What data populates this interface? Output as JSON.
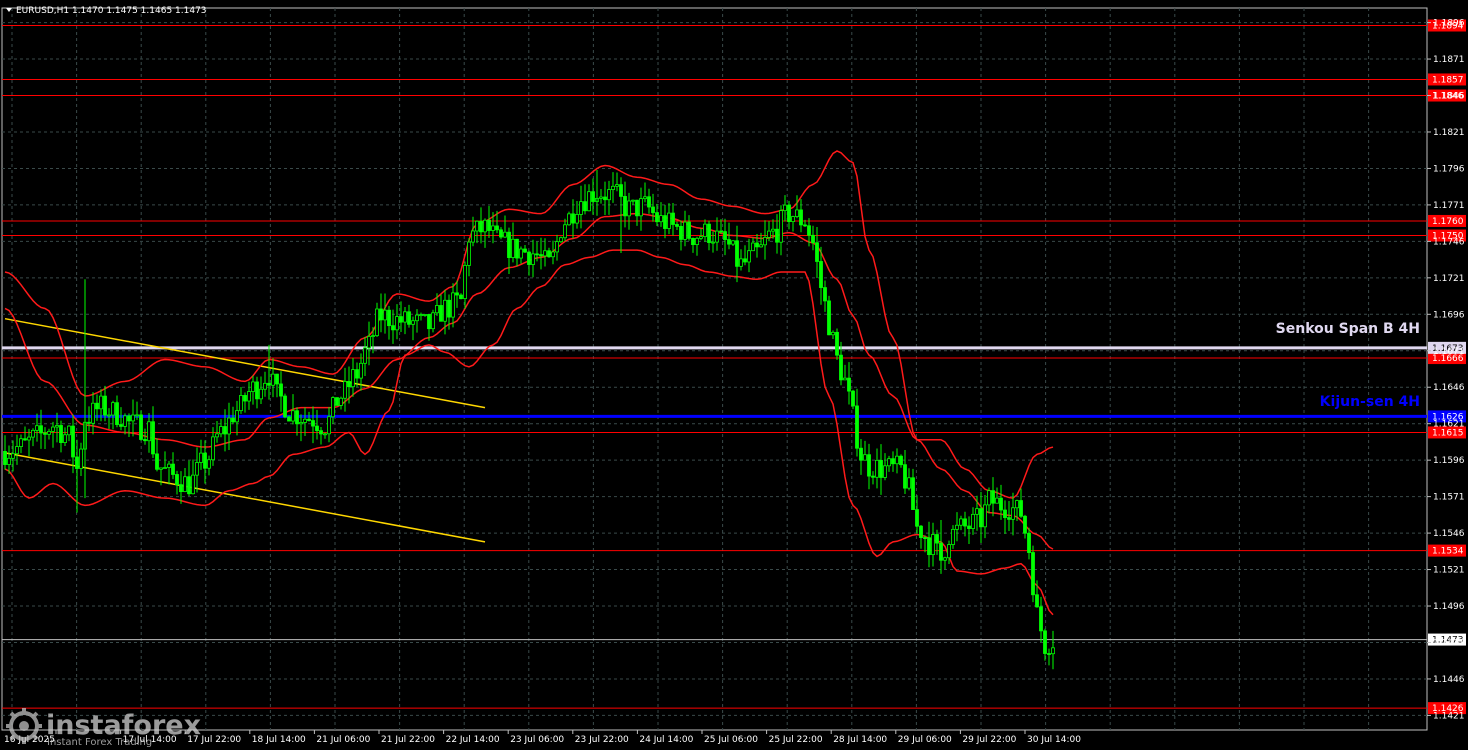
{
  "window": {
    "symbol_header": "EURUSD,H1  1.1470 1.1475 1.1465 1.1473"
  },
  "colors": {
    "background": "#000000",
    "grid": "#3a4a4a",
    "bull_candle": "#00ff00",
    "bear_candle": "#00ff00",
    "level": "#ff0000",
    "bollinger": "#ff1a1a",
    "channel": "#ffd700",
    "kijun": "#0000ff",
    "senkou": "#e0d8f0",
    "price_line": "#c0c0c0"
  },
  "labels": {
    "senkou": "Senkou Span B 4H",
    "kijun": "Kijun-sen 4H"
  },
  "watermark": {
    "brand": "instaforex",
    "tagline": "Instant Forex Trading",
    "icon": "gear-logo-icon"
  },
  "chart_data": {
    "type": "candlestick",
    "symbol": "EURUSD",
    "timeframe": "H1",
    "ohlc_last": {
      "open": 1.147,
      "high": 1.1475,
      "low": 1.1465,
      "close": 1.1473
    },
    "ylim": [
      1.1411,
      1.1906
    ],
    "y_ticks": [
      "1.1421",
      "1.1446",
      "1.1471",
      "1.1496",
      "1.1521",
      "1.1546",
      "1.1571",
      "1.1596",
      "1.1621",
      "1.1646",
      "1.1671",
      "1.1696",
      "1.1721",
      "1.1746",
      "1.1771",
      "1.1796",
      "1.1821",
      "1.1846",
      "1.1871",
      "1.1896"
    ],
    "x_ticks": [
      "16 Jul 2025",
      "17 Jul 14:00",
      "17 Jul 22:00",
      "18 Jul 14:00",
      "21 Jul 06:00",
      "21 Jul 22:00",
      "22 Jul 14:00",
      "23 Jul 06:00",
      "23 Jul 22:00",
      "24 Jul 14:00",
      "25 Jul 06:00",
      "25 Jul 22:00",
      "28 Jul 14:00",
      "29 Jul 06:00",
      "29 Jul 22:00",
      "30 Jul 14:00"
    ],
    "levels": [
      {
        "value": 1.1894,
        "label": "1.1894"
      },
      {
        "value": 1.1857,
        "label": "1.1857"
      },
      {
        "value": 1.1846,
        "label": "1.1846"
      },
      {
        "value": 1.176,
        "label": "1.1760"
      },
      {
        "value": 1.175,
        "label": "1.1750"
      },
      {
        "value": 1.1666,
        "label": "1.1666"
      },
      {
        "value": 1.1615,
        "label": "1.1615"
      },
      {
        "value": 1.1534,
        "label": "1.1534"
      },
      {
        "value": 1.1426,
        "label": "1.1426"
      }
    ],
    "senkou_b": {
      "value": 1.1673,
      "label": "1.1673"
    },
    "kijun_sen": {
      "value": 1.1626,
      "label": "1.1626"
    },
    "current_price": {
      "value": 1.1473,
      "label": "1.1473"
    },
    "channel_lines": [
      {
        "x_bar": [
          0,
          120
        ],
        "y": [
          1.1693,
          1.1632
        ]
      },
      {
        "x_bar": [
          0,
          120
        ],
        "y": [
          1.1601,
          1.154
        ]
      }
    ],
    "close_path": [
      [
        0,
        1.1602
      ],
      [
        4,
        1.1605
      ],
      [
        8,
        1.1612
      ],
      [
        12,
        1.162
      ],
      [
        16,
        1.1612
      ],
      [
        18,
        1.159
      ],
      [
        20,
        1.1625
      ],
      [
        24,
        1.1632
      ],
      [
        28,
        1.1628
      ],
      [
        32,
        1.162
      ],
      [
        36,
        1.1618
      ],
      [
        38,
        1.1592
      ],
      [
        42,
        1.1585
      ],
      [
        46,
        1.158
      ],
      [
        50,
        1.1595
      ],
      [
        54,
        1.1615
      ],
      [
        58,
        1.163
      ],
      [
        62,
        1.1645
      ],
      [
        66,
        1.1655
      ],
      [
        68,
        1.164
      ],
      [
        72,
        1.1628
      ],
      [
        76,
        1.1625
      ],
      [
        80,
        1.162
      ],
      [
        84,
        1.164
      ],
      [
        88,
        1.1655
      ],
      [
        90,
        1.167
      ],
      [
        94,
        1.1695
      ],
      [
        98,
        1.1692
      ],
      [
        102,
        1.169
      ],
      [
        106,
        1.1688
      ],
      [
        110,
        1.17
      ],
      [
        114,
        1.1705
      ],
      [
        116,
        1.175
      ],
      [
        120,
        1.1755
      ],
      [
        124,
        1.1745
      ],
      [
        128,
        1.174
      ],
      [
        132,
        1.1738
      ],
      [
        136,
        1.173
      ],
      [
        140,
        1.176
      ],
      [
        144,
        1.1775
      ],
      [
        148,
        1.178
      ],
      [
        152,
        1.1778
      ],
      [
        156,
        1.1768
      ],
      [
        160,
        1.177
      ],
      [
        164,
        1.176
      ],
      [
        168,
        1.1755
      ],
      [
        172,
        1.175
      ],
      [
        176,
        1.1752
      ],
      [
        180,
        1.1745
      ],
      [
        184,
        1.173
      ],
      [
        188,
        1.1738
      ],
      [
        192,
        1.1752
      ],
      [
        196,
        1.1765
      ],
      [
        200,
        1.176
      ],
      [
        202,
        1.1745
      ],
      [
        204,
        1.1715
      ],
      [
        206,
        1.169
      ],
      [
        208,
        1.1665
      ],
      [
        210,
        1.165
      ],
      [
        212,
        1.1625
      ],
      [
        214,
        1.16
      ],
      [
        216,
        1.1592
      ],
      [
        220,
        1.159
      ],
      [
        224,
        1.159
      ],
      [
        226,
        1.1575
      ],
      [
        228,
        1.155
      ],
      [
        232,
        1.1538
      ],
      [
        234,
        1.1528
      ],
      [
        236,
        1.1545
      ],
      [
        240,
        1.155
      ],
      [
        244,
        1.1555
      ],
      [
        246,
        1.1568
      ],
      [
        250,
        1.1565
      ],
      [
        254,
        1.156
      ],
      [
        256,
        1.1535
      ],
      [
        258,
        1.149
      ],
      [
        260,
        1.147
      ],
      [
        262,
        1.1473
      ]
    ],
    "bollinger": {
      "upper": [
        [
          0,
          1.1725
        ],
        [
          10,
          1.17
        ],
        [
          20,
          1.164
        ],
        [
          30,
          1.165
        ],
        [
          40,
          1.1665
        ],
        [
          50,
          1.166
        ],
        [
          60,
          1.165
        ],
        [
          66,
          1.1665
        ],
        [
          74,
          1.166
        ],
        [
          82,
          1.1655
        ],
        [
          90,
          1.168
        ],
        [
          98,
          1.171
        ],
        [
          106,
          1.1705
        ],
        [
          112,
          1.1715
        ],
        [
          118,
          1.1758
        ],
        [
          126,
          1.1768
        ],
        [
          134,
          1.1765
        ],
        [
          142,
          1.1785
        ],
        [
          150,
          1.1798
        ],
        [
          158,
          1.179
        ],
        [
          166,
          1.1785
        ],
        [
          174,
          1.1775
        ],
        [
          182,
          1.177
        ],
        [
          190,
          1.1765
        ],
        [
          196,
          1.1768
        ],
        [
          202,
          1.1785
        ],
        [
          208,
          1.1808
        ],
        [
          212,
          1.18
        ],
        [
          216,
          1.174
        ],
        [
          222,
          1.168
        ],
        [
          228,
          1.161
        ],
        [
          234,
          1.161
        ],
        [
          240,
          1.159
        ],
        [
          246,
          1.1575
        ],
        [
          252,
          1.157
        ],
        [
          258,
          1.16
        ],
        [
          262,
          1.1605
        ]
      ],
      "middle": [
        [
          0,
          1.17
        ],
        [
          10,
          1.165
        ],
        [
          20,
          1.162
        ],
        [
          30,
          1.1615
        ],
        [
          40,
          1.161
        ],
        [
          50,
          1.1605
        ],
        [
          60,
          1.161
        ],
        [
          66,
          1.1625
        ],
        [
          74,
          1.1632
        ],
        [
          82,
          1.1632
        ],
        [
          90,
          1.1645
        ],
        [
          98,
          1.1665
        ],
        [
          106,
          1.168
        ],
        [
          112,
          1.169
        ],
        [
          118,
          1.171
        ],
        [
          126,
          1.1728
        ],
        [
          134,
          1.1735
        ],
        [
          142,
          1.1748
        ],
        [
          150,
          1.1763
        ],
        [
          158,
          1.1765
        ],
        [
          166,
          1.1762
        ],
        [
          174,
          1.1755
        ],
        [
          182,
          1.175
        ],
        [
          190,
          1.1748
        ],
        [
          196,
          1.1752
        ],
        [
          202,
          1.1745
        ],
        [
          208,
          1.172
        ],
        [
          212,
          1.1695
        ],
        [
          216,
          1.1668
        ],
        [
          222,
          1.164
        ],
        [
          228,
          1.161
        ],
        [
          234,
          1.159
        ],
        [
          240,
          1.1575
        ],
        [
          246,
          1.156
        ],
        [
          252,
          1.1558
        ],
        [
          258,
          1.1545
        ],
        [
          262,
          1.1535
        ]
      ],
      "lower": [
        [
          0,
          1.159
        ],
        [
          6,
          1.157
        ],
        [
          12,
          1.158
        ],
        [
          20,
          1.1565
        ],
        [
          30,
          1.1575
        ],
        [
          40,
          1.157
        ],
        [
          50,
          1.1565
        ],
        [
          56,
          1.1575
        ],
        [
          62,
          1.158
        ],
        [
          66,
          1.1585
        ],
        [
          72,
          1.16
        ],
        [
          80,
          1.1605
        ],
        [
          86,
          1.1615
        ],
        [
          90,
          1.16
        ],
        [
          96,
          1.163
        ],
        [
          100,
          1.1668
        ],
        [
          106,
          1.1675
        ],
        [
          110,
          1.167
        ],
        [
          116,
          1.166
        ],
        [
          122,
          1.1675
        ],
        [
          128,
          1.17
        ],
        [
          134,
          1.1715
        ],
        [
          140,
          1.173
        ],
        [
          146,
          1.1735
        ],
        [
          152,
          1.174
        ],
        [
          158,
          1.174
        ],
        [
          164,
          1.1735
        ],
        [
          170,
          1.173
        ],
        [
          176,
          1.1725
        ],
        [
          182,
          1.1722
        ],
        [
          188,
          1.172
        ],
        [
          194,
          1.1725
        ],
        [
          200,
          1.1725
        ],
        [
          206,
          1.164
        ],
        [
          212,
          1.1565
        ],
        [
          218,
          1.153
        ],
        [
          222,
          1.154
        ],
        [
          228,
          1.1545
        ],
        [
          234,
          1.154
        ],
        [
          238,
          1.152
        ],
        [
          244,
          1.1518
        ],
        [
          250,
          1.1522
        ],
        [
          254,
          1.1525
        ],
        [
          258,
          1.151
        ],
        [
          262,
          1.149
        ]
      ]
    }
  }
}
